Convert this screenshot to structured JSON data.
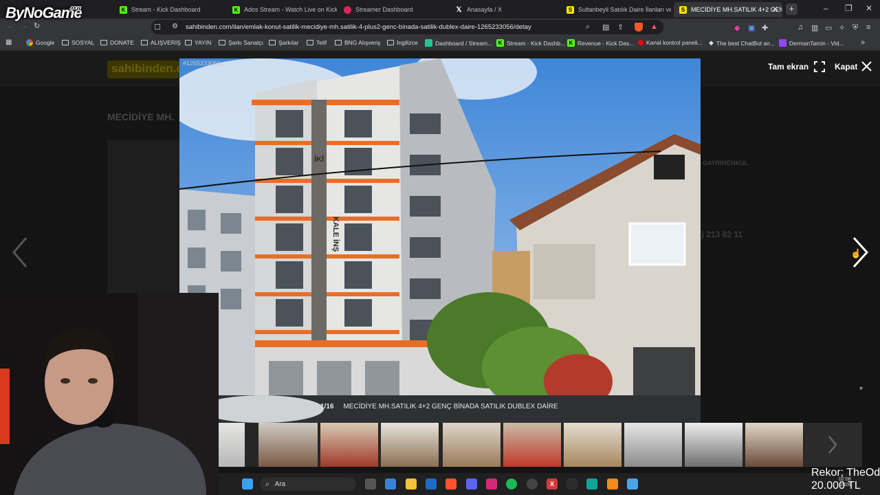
{
  "browser": {
    "tabs": [
      {
        "label": "Stream - Kick Dashboard",
        "icon": "kick-icon",
        "color": "#53fc18"
      },
      {
        "label": "Ados Stream - Watch Live on Kick",
        "icon": "kick-icon",
        "color": "#53fc18"
      },
      {
        "label": "Streamer Dashboard",
        "icon": "streamer-icon",
        "color": "#e0245e"
      },
      {
        "label": "Anasayfa / X",
        "icon": "x-icon",
        "color": "#ffffff"
      },
      {
        "label": "Sultanbeyli Satılık Daire İlanları ve S",
        "icon": "sahibinden-icon",
        "color": "#ffe800"
      },
      {
        "label": "MECİDİYE MH.SATILIK 4+2 GEN",
        "icon": "sahibinden-icon",
        "color": "#ffe800"
      }
    ],
    "url": "sahibinden.com/ilan/emlak-konut-satilik-mecidiye-mh.satilik-4-plus2-genc-binada-satilik-dublex-daire-1265233056/detay",
    "bookmarks": [
      "Google",
      "SOSYAL",
      "DONATE",
      "ALIŞVERİŞ",
      "YAYIN",
      "Şarkı Sanatçı",
      "Şarkılar",
      "Telif",
      "BNG Alışveriş",
      "İngilizce",
      "Dashboard / Stream...",
      "Stream - Kick Dashb...",
      "Revenue - Kick Das...",
      "Kanal kontrol paneli...",
      "The best ChatBot an...",
      "DermanTarcin - Vid..."
    ]
  },
  "overlay_logo": {
    "text": "ByNoGame",
    "suffix": ".com"
  },
  "gallery": {
    "listing_id": "#1265233056",
    "fullscreen_label": "Tam ekran",
    "close_label": "Kapat",
    "counter": "1/16",
    "caption": "MECİDİYE MH.SATILIK 4+2 GENÇ BİNADA SATILIK DUBLEX DAİRE",
    "building_sign": "KALE İNŞ",
    "building_sign_top": "İKİ"
  },
  "background_page": {
    "logo": "sahibinden.c",
    "title": "MECİDİYE MH.",
    "agency": "GAYRIMENKUL",
    "phone": ") 213 82 11"
  },
  "taskbar": {
    "search_placeholder": "Ara"
  },
  "stream_overlay": {
    "record_line1": "Rekor; TheOd",
    "record_line2": "20.000 TL"
  },
  "clock": {
    "time": "02:08",
    "date": "2026"
  }
}
